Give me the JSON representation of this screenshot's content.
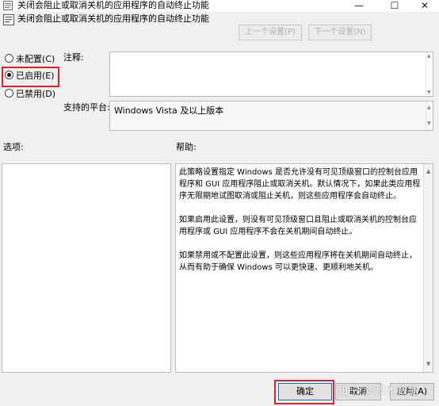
{
  "window": {
    "title": "关闭会阻止或取消关机的应用程序的自动终止功能",
    "min_glyph": "—",
    "max_glyph": "☐",
    "close_glyph": "✕"
  },
  "header": {
    "policy_title": "关闭会阻止或取消关机的应用程序的自动终止功能",
    "prev_label": "上一个设置(P)",
    "next_label": "下一个设置(N)"
  },
  "state": {
    "not_configured_label": "未配置(C)",
    "enabled_label": "已启用(E)",
    "disabled_label": "已禁用(D)",
    "selected": "enabled"
  },
  "labels": {
    "comment": "注释:",
    "platform": "支持的平台:",
    "options": "选项:",
    "help": "帮助:"
  },
  "fields": {
    "comment_value": "",
    "platform_value": "Windows Vista 及以上版本"
  },
  "help": {
    "paragraphs": [
      "此策略设置指定 Windows 是否允许没有可见顶级窗口的控制台应用程序和 GUI 应用程序阻止或取消关机。默认情况下，如果此类应用程序无限期地试图取消或阻止关机，则这些应用程序会自动终止。",
      "如果启用此设置，则没有可见顶级窗口且阻止或取消关机的控制台应用程序或 GUI 应用程序不会在关机期间自动终止。",
      "如果禁用或不配置此设置，则这些应用程序将在关机期间自动终止，从而有助于确保 Windows 可以更快速、更顺利地关机。"
    ]
  },
  "buttons": {
    "ok": "确定",
    "cancel": "取消",
    "apply": "应用(A)"
  },
  "watermark": "知乎 @积木数据",
  "colors": {
    "highlight": "#e0202b",
    "focus_border": "#0078d7"
  }
}
